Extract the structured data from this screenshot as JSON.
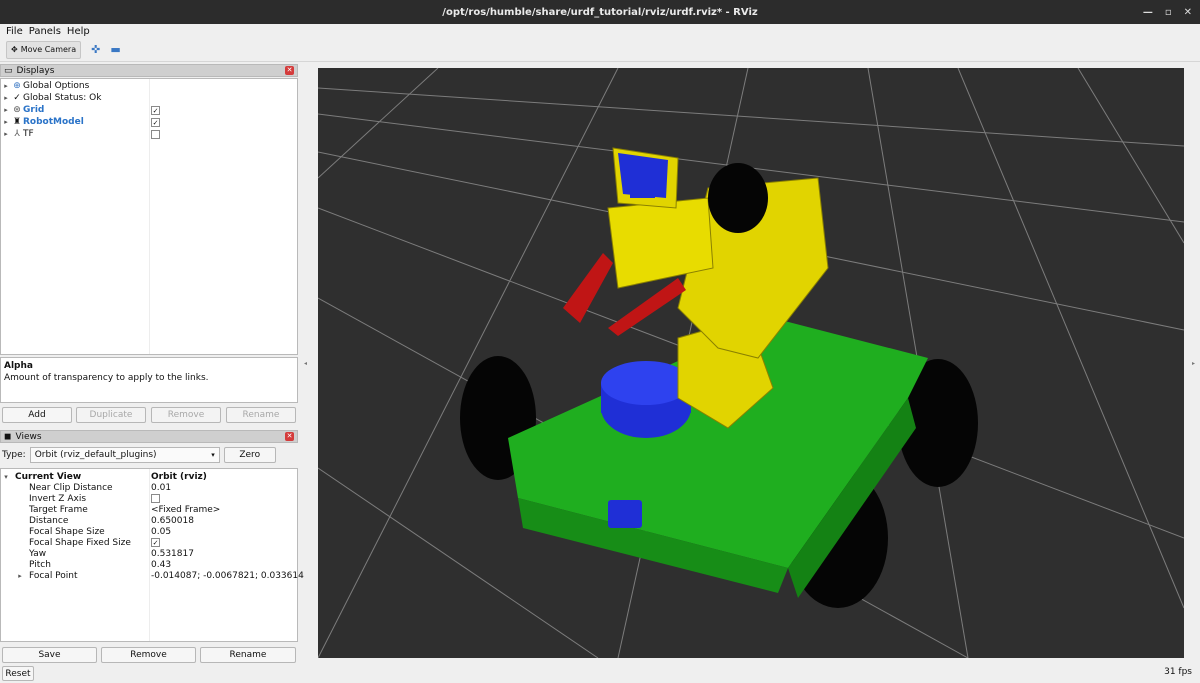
{
  "window": {
    "title": "/opt/ros/humble/share/urdf_tutorial/rviz/urdf.rviz* - RViz"
  },
  "menu": {
    "items": [
      "File",
      "Panels",
      "Help"
    ]
  },
  "toolbar": {
    "move_camera_label": "Move Camera"
  },
  "displays": {
    "title": "Displays",
    "items": [
      {
        "label": "Global Options"
      },
      {
        "label": "Global Status: Ok"
      },
      {
        "label": "Grid",
        "checked": true
      },
      {
        "label": "RobotModel",
        "checked": true
      },
      {
        "label": "TF",
        "checked": false
      }
    ],
    "desc_title": "Alpha",
    "desc_text": "Amount of transparency to apply to the links.",
    "buttons": {
      "add": "Add",
      "duplicate": "Duplicate",
      "remove": "Remove",
      "rename": "Rename"
    }
  },
  "views": {
    "title": "Views",
    "type_label": "Type:",
    "type_value": "Orbit (rviz_default_plugins)",
    "zero_label": "Zero",
    "current_view_label": "Current View",
    "current_view_value": "Orbit (rviz)",
    "props": [
      {
        "name": "Near Clip Distance",
        "value": "0.01"
      },
      {
        "name": "Invert Z Axis",
        "value": ""
      },
      {
        "name": "Target Frame",
        "value": "<Fixed Frame>"
      },
      {
        "name": "Distance",
        "value": "0.650018"
      },
      {
        "name": "Focal Shape Size",
        "value": "0.05"
      },
      {
        "name": "Focal Shape Fixed Size",
        "value": ""
      },
      {
        "name": "Yaw",
        "value": "0.531817"
      },
      {
        "name": "Pitch",
        "value": "0.43"
      },
      {
        "name": "Focal Point",
        "value": "-0.014087; -0.0067821; 0.033614"
      }
    ],
    "buttons": {
      "save": "Save",
      "remove": "Remove",
      "rename": "Rename"
    }
  },
  "status": {
    "reset_label": "Reset",
    "fps": "31 fps"
  },
  "colors": {
    "grid_line": "#8a8a8a",
    "viewport_bg": "#2f2f2f",
    "chassis_green": "#1fae1f",
    "arm_yellow": "#e1d400",
    "servo_blue": "#1f2fd6",
    "gripper_red": "#c01515",
    "wheel_black": "#050505"
  }
}
